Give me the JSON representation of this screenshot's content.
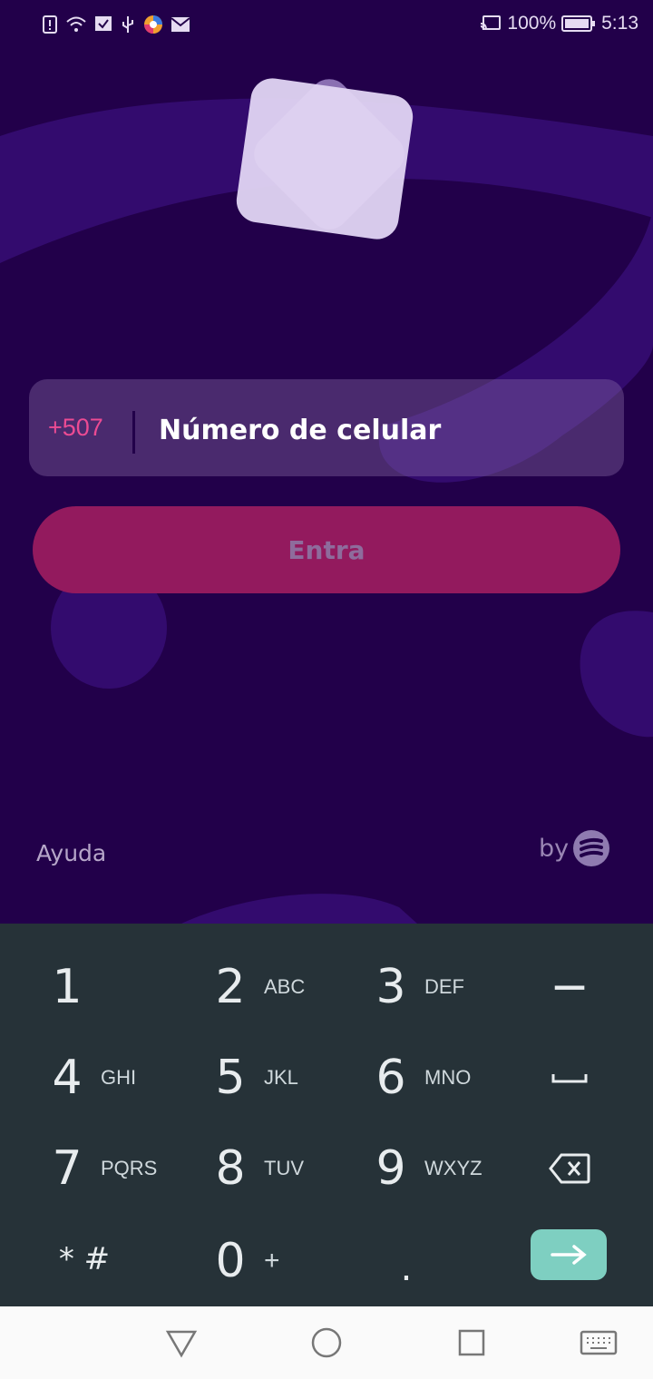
{
  "status_bar": {
    "battery": "100%",
    "time": "5:13"
  },
  "login": {
    "country_code": "+507",
    "phone_placeholder": "Número de celular",
    "submit_label": "Entra",
    "help_label": "Ayuda",
    "by_label": "by"
  },
  "keypad": {
    "rows": [
      [
        {
          "digit": "1",
          "letters": ""
        },
        {
          "digit": "2",
          "letters": "ABC"
        },
        {
          "digit": "3",
          "letters": "DEF"
        },
        {
          "digit": "−",
          "letters": ""
        }
      ],
      [
        {
          "digit": "4",
          "letters": "GHI"
        },
        {
          "digit": "5",
          "letters": "JKL"
        },
        {
          "digit": "6",
          "letters": "MNO"
        },
        {
          "digit": "␣",
          "letters": ""
        }
      ],
      [
        {
          "digit": "7",
          "letters": "PQRS"
        },
        {
          "digit": "8",
          "letters": "TUV"
        },
        {
          "digit": "9",
          "letters": "WXYZ"
        },
        {
          "digit": "⌫",
          "letters": ""
        }
      ],
      [
        {
          "digit": "* #",
          "letters": ""
        },
        {
          "digit": "0",
          "letters": "+"
        },
        {
          "digit": ".",
          "letters": ""
        },
        {
          "digit": "→",
          "letters": ""
        }
      ]
    ],
    "enter_color": "#7ecfc1"
  },
  "colors": {
    "background": "#22004a",
    "accent": "#ec4b93",
    "button": "#931a5e"
  }
}
